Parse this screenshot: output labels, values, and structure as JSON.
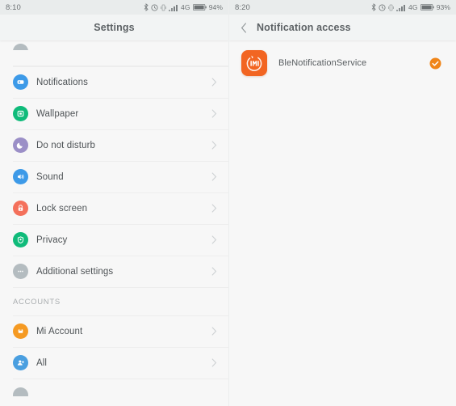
{
  "left": {
    "statusbar": {
      "time": "8:10",
      "network": "4G",
      "battery_pct": "94%",
      "icons": [
        "bluetooth-icon",
        "alarm-icon",
        "vibrate-icon",
        "signal-icon",
        "battery-icon"
      ]
    },
    "header": {
      "title": "Settings"
    },
    "partial_top_label": "",
    "items": [
      {
        "label": "Notifications",
        "icon": "notifications-icon",
        "color": "#3d9ae8"
      },
      {
        "label": "Wallpaper",
        "icon": "wallpaper-icon",
        "color": "#0fbb7a"
      },
      {
        "label": "Do not disturb",
        "icon": "do-not-disturb-icon",
        "color": "#9b8fc7"
      },
      {
        "label": "Sound",
        "icon": "sound-icon",
        "color": "#3d9ae8"
      },
      {
        "label": "Lock screen",
        "icon": "lock-screen-icon",
        "color": "#f4705b"
      },
      {
        "label": "Privacy",
        "icon": "privacy-icon",
        "color": "#0fbb7a"
      },
      {
        "label": "Additional settings",
        "icon": "additional-settings-icon",
        "color": "#b4bcc0"
      }
    ],
    "accounts_section": {
      "title": "ACCOUNTS"
    },
    "accounts": [
      {
        "label": "Mi Account",
        "icon": "mi-account-icon",
        "color": "#f59a23"
      },
      {
        "label": "All",
        "icon": "all-accounts-icon",
        "color": "#4a9fe0"
      }
    ],
    "chevron": "chevron-right-icon"
  },
  "right": {
    "statusbar": {
      "time": "8:20",
      "network": "4G",
      "battery_pct": "93%"
    },
    "header": {
      "title": "Notification access",
      "back_icon": "chevron-left-icon"
    },
    "apps": [
      {
        "name": "BleNotificationService",
        "icon": "mi-app-icon",
        "icon_color": "#f26522",
        "enabled": true,
        "badge_icon": "check-circle-icon",
        "badge_color": "#f08519"
      }
    ]
  }
}
